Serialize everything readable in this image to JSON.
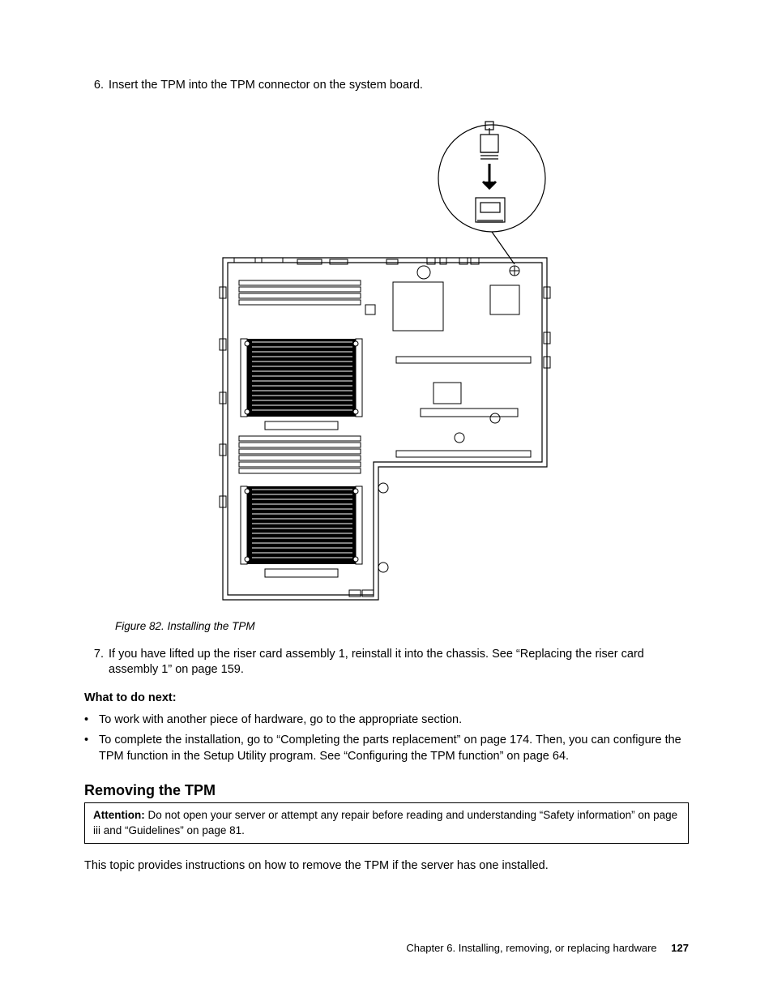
{
  "steps": {
    "six": {
      "num": "6.",
      "text": "Insert the TPM into the TPM connector on the system board."
    },
    "seven": {
      "num": "7.",
      "text": "If you have lifted up the riser card assembly 1, reinstall it into the chassis. See “Replacing the riser card assembly 1” on page 159."
    }
  },
  "figure": {
    "caption": "Figure 82.  Installing the TPM"
  },
  "what_next_heading": "What to do next:",
  "bullets": {
    "b1": "To work with another piece of hardware, go to the appropriate section.",
    "b2": "To complete the installation, go to “Completing the parts replacement” on page 174. Then, you can configure the TPM function in the Setup Utility program. See “Configuring the TPM function” on page 64."
  },
  "section_heading": "Removing the TPM",
  "attention": {
    "label": "Attention:",
    "text": " Do not open your server or attempt any repair before reading and understanding “Safety information” on page iii and “Guidelines” on page 81."
  },
  "intro_para": "This topic provides instructions on how to remove the TPM if the server has one installed.",
  "footer": {
    "chapter": "Chapter 6.  Installing, removing, or replacing hardware",
    "page": "127"
  }
}
